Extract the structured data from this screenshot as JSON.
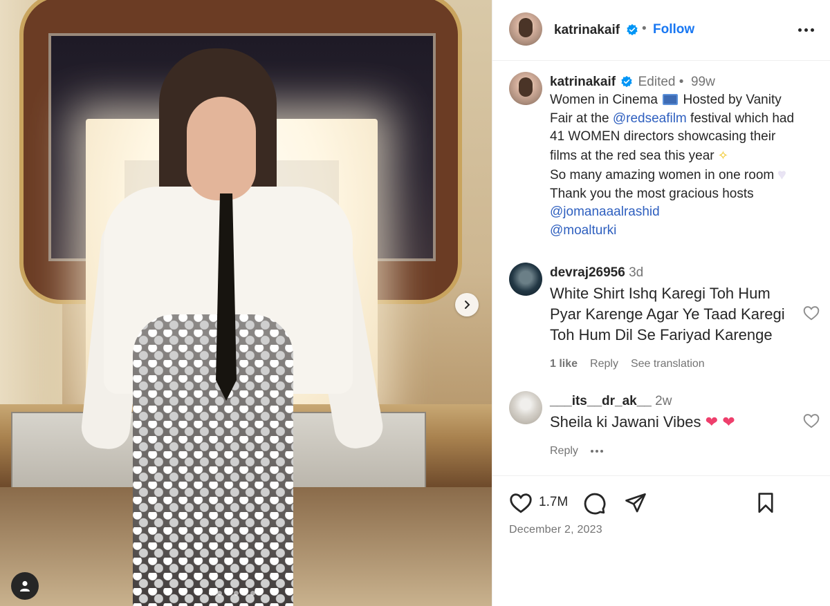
{
  "post": {
    "username": "katrinakaif",
    "follow_label": "Follow",
    "separator": "•"
  },
  "caption": {
    "username": "katrinakaif",
    "edited": "Edited",
    "separator": "•",
    "age": "99w",
    "lines": [
      "Women in Cinema",
      "Hosted by Vanity",
      "Fair at the",
      "@redseafilm",
      "festival which had",
      "41 WOMEN directors showcasing their",
      "films at the red sea this year",
      "So many amazing women in one room",
      "Thank you the most gracious hosts",
      "@jomanaaalrashid",
      "@moalturki"
    ]
  },
  "comments": [
    {
      "username": "devraj26956",
      "age": "3d",
      "text_lines": [
        "White Shirt Ishq Karegi Toh Hum",
        "Pyar Karenge Agar Ye Taad Karegi",
        "Toh Hum Dil Se Fariyad Karenge"
      ],
      "likes": "1 like",
      "reply": "Reply",
      "translate": "See translation"
    },
    {
      "username": "___its__dr_ak__",
      "age": "2w",
      "text": "Sheila ki Jawani Vibes",
      "reply": "Reply"
    }
  ],
  "actions": {
    "like_count": "1.7M",
    "date": "December 2, 2023"
  },
  "carousel": {
    "total_slides": 6,
    "active_slide": 1
  },
  "icons": {
    "verified": "verified-badge-icon",
    "more": "more-options-icon",
    "heart": "heart-icon",
    "comment": "comment-icon",
    "share": "share-icon",
    "save": "bookmark-icon",
    "next": "chevron-right-icon",
    "tag": "user-tag-icon"
  },
  "colors": {
    "accent": "#1877f2",
    "mention": "#2e5fbf",
    "muted": "#737373",
    "text": "#262626"
  }
}
